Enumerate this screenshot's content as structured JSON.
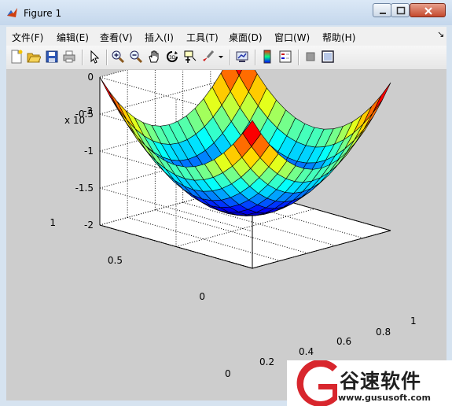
{
  "window": {
    "title": "Figure 1"
  },
  "menu": [
    "文件(F)",
    "编辑(E)",
    "查看(V)",
    "插入(I)",
    "工具(T)",
    "桌面(D)",
    "窗口(W)",
    "帮助(H)"
  ],
  "menu_chevron": "↘",
  "toolbar": [
    "new-figure",
    "open-file",
    "save-figure",
    "print-figure",
    "edit-plot",
    "zoom-in",
    "zoom-out",
    "pan",
    "rotate-3d",
    "data-cursor",
    "brush",
    "link-plot",
    "colorbar",
    "legend",
    "hide-plot-tools",
    "show-plot-tools"
  ],
  "axes": {
    "exponent_label": "x 10",
    "exponent_sup": "-3",
    "z_ticks": [
      "0",
      "-0.5",
      "-1",
      "-1.5",
      "-2"
    ],
    "y_ticks": [
      "1",
      "0.5",
      "0"
    ],
    "x_ticks": [
      "0",
      "0.2",
      "0.4",
      "0.6",
      "0.8",
      "1"
    ]
  },
  "watermark": {
    "text": "谷速软件",
    "url": "www.gususoft.com"
  },
  "colors": {
    "surface_low": "#0000b0",
    "surface_mid": "#40ffc0",
    "surface_high": "#800000",
    "figure_bg": "#cdcdcd"
  }
}
